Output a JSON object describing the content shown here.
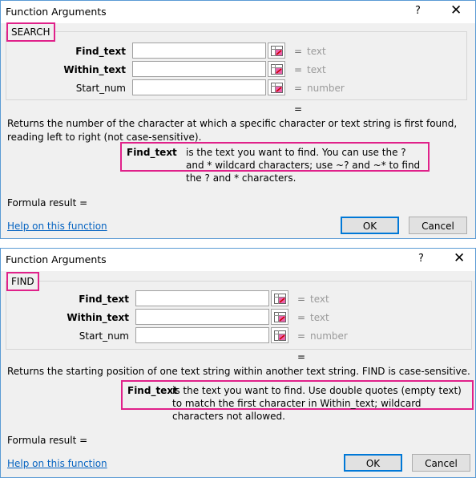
{
  "dialogs": [
    {
      "title": "Function Arguments",
      "help_glyph": "?",
      "close_glyph": "✕",
      "function_name": "SEARCH",
      "args": [
        {
          "label": "Find_text",
          "value": "",
          "type_hint": "text",
          "bold": true
        },
        {
          "label": "Within_text",
          "value": "",
          "type_hint": "text",
          "bold": true
        },
        {
          "label": "Start_num",
          "value": "",
          "type_hint": "number",
          "bold": false
        }
      ],
      "equals": "=",
      "result_equals": "=",
      "description": "Returns the number of the character at which a specific character or text string is first found, reading left to right (not case-sensitive).",
      "arg_description": {
        "name": "Find_text",
        "text": "is the text you want to find. You can use the ? and * wildcard characters; use ~? and ~* to find the ? and * characters."
      },
      "formula_result": "Formula result =",
      "help_link": "Help on this function",
      "ok_label": "OK",
      "cancel_label": "Cancel"
    },
    {
      "title": "Function Arguments",
      "help_glyph": "?",
      "close_glyph": "✕",
      "function_name": "FIND",
      "args": [
        {
          "label": "Find_text",
          "value": "",
          "type_hint": "text",
          "bold": true
        },
        {
          "label": "Within_text",
          "value": "",
          "type_hint": "text",
          "bold": true
        },
        {
          "label": "Start_num",
          "value": "",
          "type_hint": "number",
          "bold": false
        }
      ],
      "equals": "=",
      "result_equals": "=",
      "description": "Returns the starting position of one text string within another text string. FIND is case-sensitive.",
      "arg_description": {
        "name": "Find_text",
        "text": "is the text you want to find. Use double quotes (empty text) to match the first character in Within_text; wildcard characters not allowed."
      },
      "formula_result": "Formula result =",
      "help_link": "Help on this function",
      "ok_label": "OK",
      "cancel_label": "Cancel"
    }
  ],
  "colors": {
    "highlight": "#e0218a",
    "link": "#0563c1",
    "dialog_border": "#5b9bd5",
    "default_button_border": "#0078d7"
  },
  "icons": {
    "range_select": "range-selector-icon",
    "close": "close-icon",
    "help": "help-icon"
  }
}
